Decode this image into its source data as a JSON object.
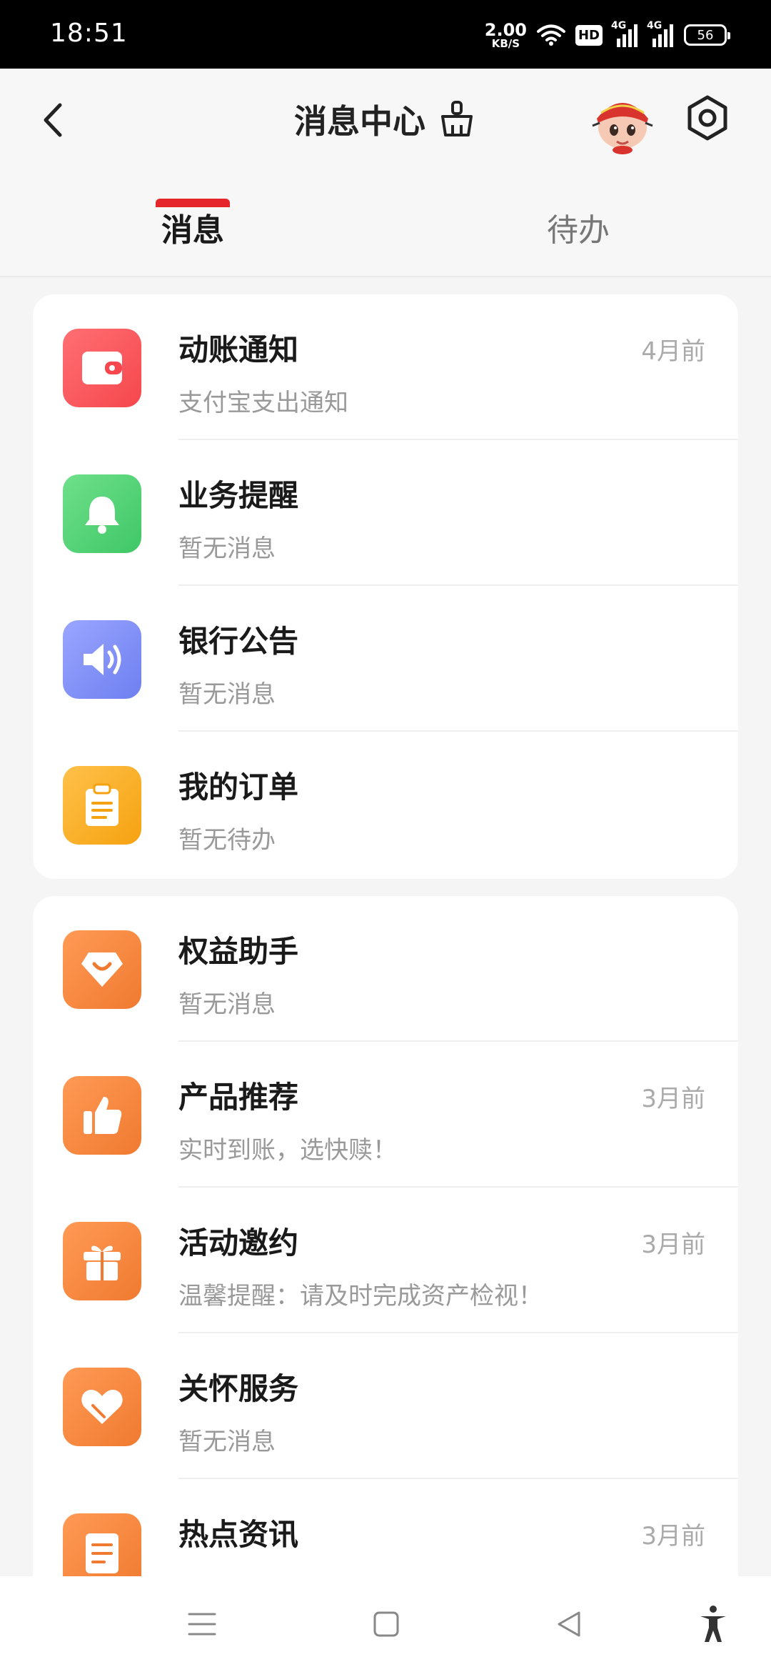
{
  "status_bar": {
    "time": "18:51",
    "net_speed_value": "2.00",
    "net_speed_unit": "KB/S",
    "hd_label": "HD",
    "signal1_label": "4G",
    "signal2_label": "4G",
    "battery": "56"
  },
  "header": {
    "title": "消息中心",
    "tabs": [
      {
        "label": "消息",
        "active": true
      },
      {
        "label": "待办",
        "active": false
      }
    ],
    "accent_color": "#e5262b"
  },
  "cards": [
    {
      "items": [
        {
          "name": "动账通知",
          "subtitle": "支付宝支出通知",
          "time": "4月前",
          "icon": "wallet-icon"
        },
        {
          "name": "业务提醒",
          "subtitle": "暂无消息",
          "time": "",
          "icon": "bell-icon"
        },
        {
          "name": "银行公告",
          "subtitle": "暂无消息",
          "time": "",
          "icon": "speaker-icon"
        },
        {
          "name": "我的订单",
          "subtitle": "暂无待办",
          "time": "",
          "icon": "clipboard-icon"
        }
      ]
    },
    {
      "items": [
        {
          "name": "权益助手",
          "subtitle": "暂无消息",
          "time": "",
          "icon": "gem-icon"
        },
        {
          "name": "产品推荐",
          "subtitle": "实时到账，选快赎！",
          "time": "3月前",
          "icon": "thumbs-up-icon"
        },
        {
          "name": "活动邀约",
          "subtitle": "温馨提醒：请及时完成资产检视！",
          "time": "3月前",
          "icon": "gift-icon"
        },
        {
          "name": "关怀服务",
          "subtitle": "暂无消息",
          "time": "",
          "icon": "heart-icon"
        },
        {
          "name": "热点资讯",
          "subtitle": "",
          "time": "3月前",
          "icon": "document-icon"
        }
      ]
    }
  ],
  "nav_bar": [
    "menu-icon",
    "home-square-icon",
    "back-triangle-icon",
    "accessibility-icon"
  ]
}
